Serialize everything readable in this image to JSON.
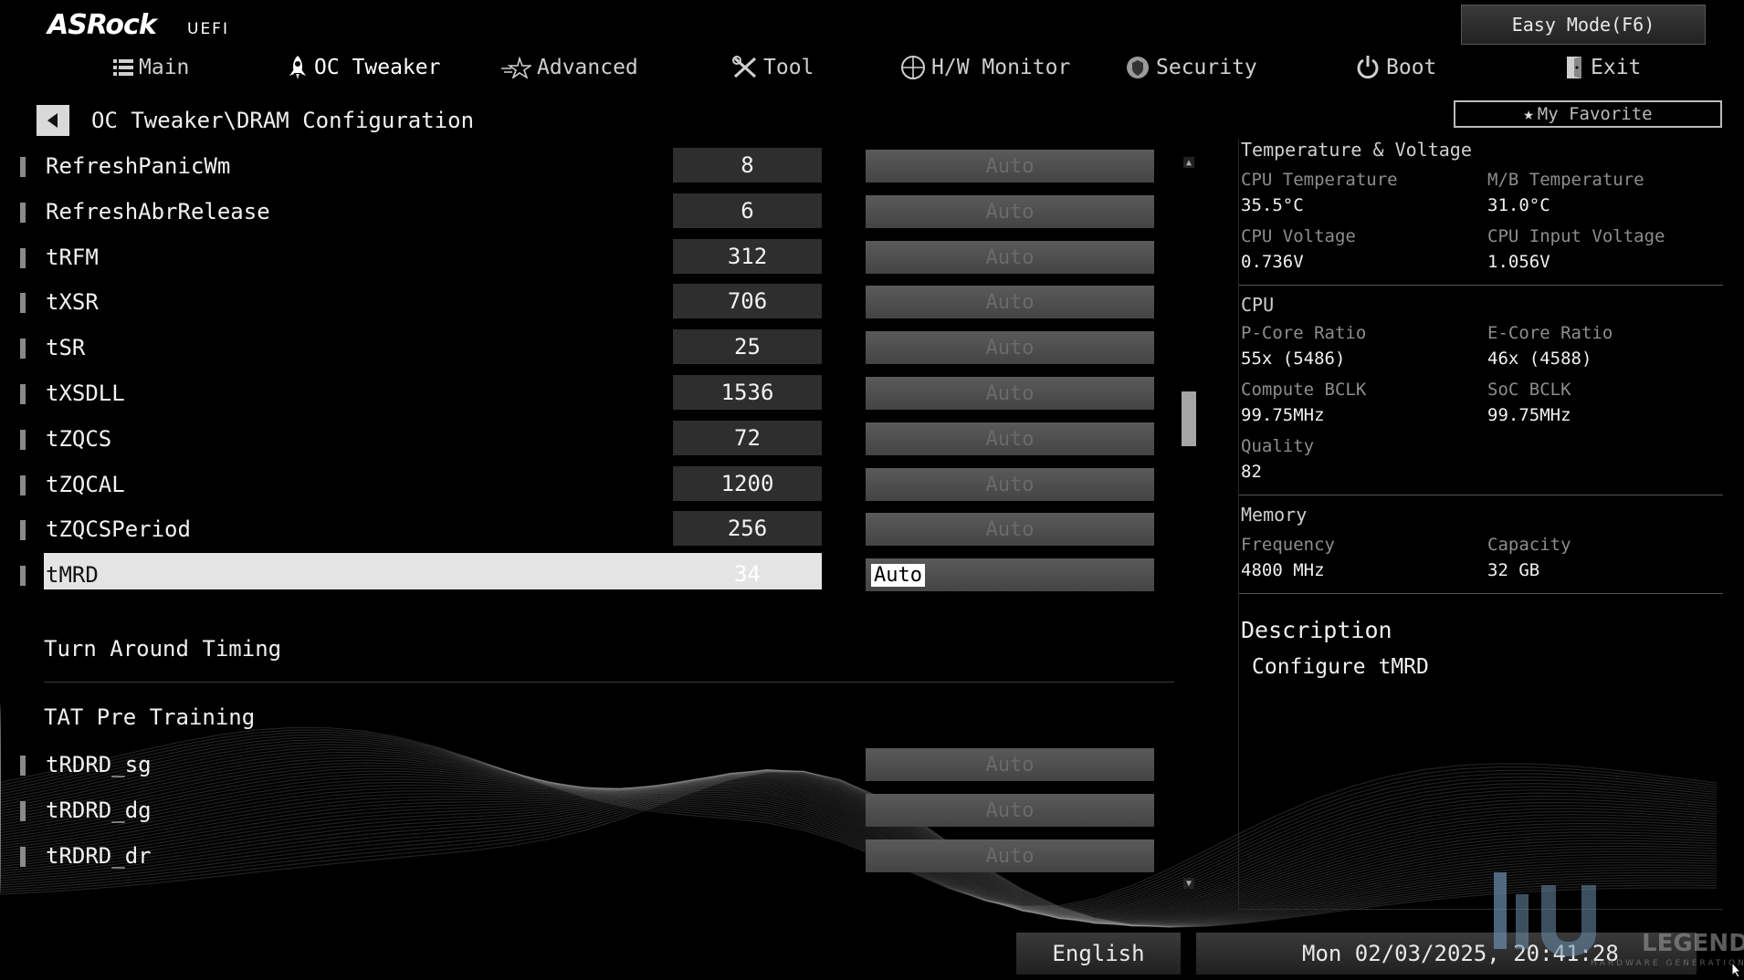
{
  "header": {
    "brand": "ASRock",
    "brand_sub": "UEFI",
    "easy_mode_label": "Easy Mode(F6)",
    "my_favorite_label": "My Favorite"
  },
  "tabs": [
    {
      "label": "Main",
      "icon": "list-icon"
    },
    {
      "label": "OC Tweaker",
      "icon": "rocket-icon",
      "active": true
    },
    {
      "label": "Advanced",
      "icon": "star-icon"
    },
    {
      "label": "Tool",
      "icon": "tools-icon"
    },
    {
      "label": "H/W Monitor",
      "icon": "crosshair-icon"
    },
    {
      "label": "Security",
      "icon": "shield-icon"
    },
    {
      "label": "Boot",
      "icon": "power-icon"
    },
    {
      "label": "Exit",
      "icon": "exit-icon"
    }
  ],
  "breadcrumb": "OC Tweaker\\DRAM Configuration",
  "settings": [
    {
      "name": "RefreshPanicWm",
      "value": "8",
      "option": "Auto"
    },
    {
      "name": "RefreshAbrRelease",
      "value": "6",
      "option": "Auto"
    },
    {
      "name": "tRFM",
      "value": "312",
      "option": "Auto"
    },
    {
      "name": "tXSR",
      "value": "706",
      "option": "Auto"
    },
    {
      "name": "tSR",
      "value": "25",
      "option": "Auto"
    },
    {
      "name": "tXSDLL",
      "value": "1536",
      "option": "Auto"
    },
    {
      "name": "tZQCS",
      "value": "72",
      "option": "Auto"
    },
    {
      "name": "tZQCAL",
      "value": "1200",
      "option": "Auto"
    },
    {
      "name": "tZQCSPeriod",
      "value": "256",
      "option": "Auto"
    },
    {
      "name": "tMRD",
      "value": "34",
      "option": "Auto",
      "selected": true
    }
  ],
  "section_turn_around": "Turn Around Timing",
  "section_tat_pre": "TAT Pre Training",
  "tat_settings": [
    {
      "name": "tRDRD_sg",
      "option": "Auto"
    },
    {
      "name": "tRDRD_dg",
      "option": "Auto"
    },
    {
      "name": "tRDRD_dr",
      "option": "Auto"
    }
  ],
  "scrollbar": {
    "position_fraction": 0.34
  },
  "monitor": {
    "temp_volt_title": "Temperature & Voltage",
    "cpu_temp_label": "CPU Temperature",
    "cpu_temp": "35.5°C",
    "mb_temp_label": "M/B Temperature",
    "mb_temp": "31.0°C",
    "cpu_volt_label": "CPU Voltage",
    "cpu_volt": "0.736V",
    "cpu_input_volt_label": "CPU Input Voltage",
    "cpu_input_volt": "1.056V",
    "cpu_title": "CPU",
    "pcore_label": "P-Core Ratio",
    "pcore": "55x (5486)",
    "ecore_label": "E-Core Ratio",
    "ecore": "46x (4588)",
    "compute_bclk_label": "Compute BCLK",
    "compute_bclk": "99.75MHz",
    "soc_bclk_label": "SoC BCLK",
    "soc_bclk": "99.75MHz",
    "quality_label": "Quality",
    "quality": "82",
    "memory_title": "Memory",
    "freq_label": "Frequency",
    "freq": "4800 MHz",
    "capacity_label": "Capacity",
    "capacity": "32 GB"
  },
  "description": {
    "title": "Description",
    "text": "Configure tMRD"
  },
  "footer": {
    "language": "English",
    "datetime": "Mon 02/03/2025, 20:41:28"
  },
  "watermark": {
    "text": "LEGEND",
    "sub": "HARDWARE GENERATION"
  },
  "colors": {
    "background": "#000000",
    "highlight": "#e4e4e4",
    "option_bg": "#4f4f4f"
  }
}
